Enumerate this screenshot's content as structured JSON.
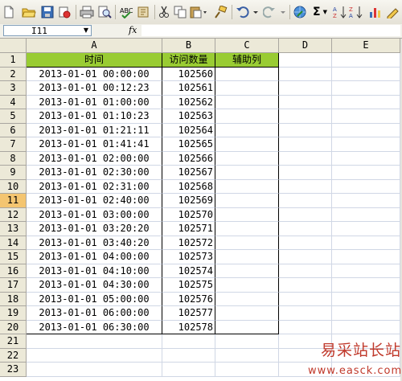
{
  "namebox": {
    "value": "I11",
    "arrow": "▼"
  },
  "fx_label": "fx",
  "columns": [
    "A",
    "B",
    "C",
    "D",
    "E"
  ],
  "rows": [
    {
      "n": "1",
      "a": "时间",
      "b": "访问数量",
      "c": "辅助列"
    },
    {
      "n": "2",
      "a": "2013-01-01  00:00:00",
      "b": "102560",
      "c": ""
    },
    {
      "n": "3",
      "a": "2013-01-01  00:12:23",
      "b": "102561",
      "c": ""
    },
    {
      "n": "4",
      "a": "2013-01-01  01:00:00",
      "b": "102562",
      "c": ""
    },
    {
      "n": "5",
      "a": "2013-01-01  01:10:23",
      "b": "102563",
      "c": ""
    },
    {
      "n": "6",
      "a": "2013-01-01  01:21:11",
      "b": "102564",
      "c": ""
    },
    {
      "n": "7",
      "a": "2013-01-01  01:41:41",
      "b": "102565",
      "c": ""
    },
    {
      "n": "8",
      "a": "2013-01-01  02:00:00",
      "b": "102566",
      "c": ""
    },
    {
      "n": "9",
      "a": "2013-01-01  02:30:00",
      "b": "102567",
      "c": ""
    },
    {
      "n": "10",
      "a": "2013-01-01  02:31:00",
      "b": "102568",
      "c": ""
    },
    {
      "n": "11",
      "a": "2013-01-01  02:40:00",
      "b": "102569",
      "c": ""
    },
    {
      "n": "12",
      "a": "2013-01-01  03:00:00",
      "b": "102570",
      "c": ""
    },
    {
      "n": "13",
      "a": "2013-01-01  03:20:20",
      "b": "102571",
      "c": ""
    },
    {
      "n": "14",
      "a": "2013-01-01  03:40:20",
      "b": "102572",
      "c": ""
    },
    {
      "n": "15",
      "a": "2013-01-01  04:00:00",
      "b": "102573",
      "c": ""
    },
    {
      "n": "16",
      "a": "2013-01-01  04:10:00",
      "b": "102574",
      "c": ""
    },
    {
      "n": "17",
      "a": "2013-01-01  04:30:00",
      "b": "102575",
      "c": ""
    },
    {
      "n": "18",
      "a": "2013-01-01  05:00:00",
      "b": "102576",
      "c": ""
    },
    {
      "n": "19",
      "a": "2013-01-01  06:00:00",
      "b": "102577",
      "c": ""
    },
    {
      "n": "20",
      "a": "2013-01-01  06:30:00",
      "b": "102578",
      "c": ""
    },
    {
      "n": "21",
      "a": "",
      "b": "",
      "c": ""
    },
    {
      "n": "22",
      "a": "",
      "b": "",
      "c": ""
    },
    {
      "n": "23",
      "a": "",
      "b": "",
      "c": ""
    }
  ],
  "active_row": "11",
  "header_fill_color": "#99cc33",
  "toolbar": {
    "sum_symbol": "Σ"
  },
  "watermark": {
    "title": "易采站长站",
    "url": "www.easck.com"
  }
}
